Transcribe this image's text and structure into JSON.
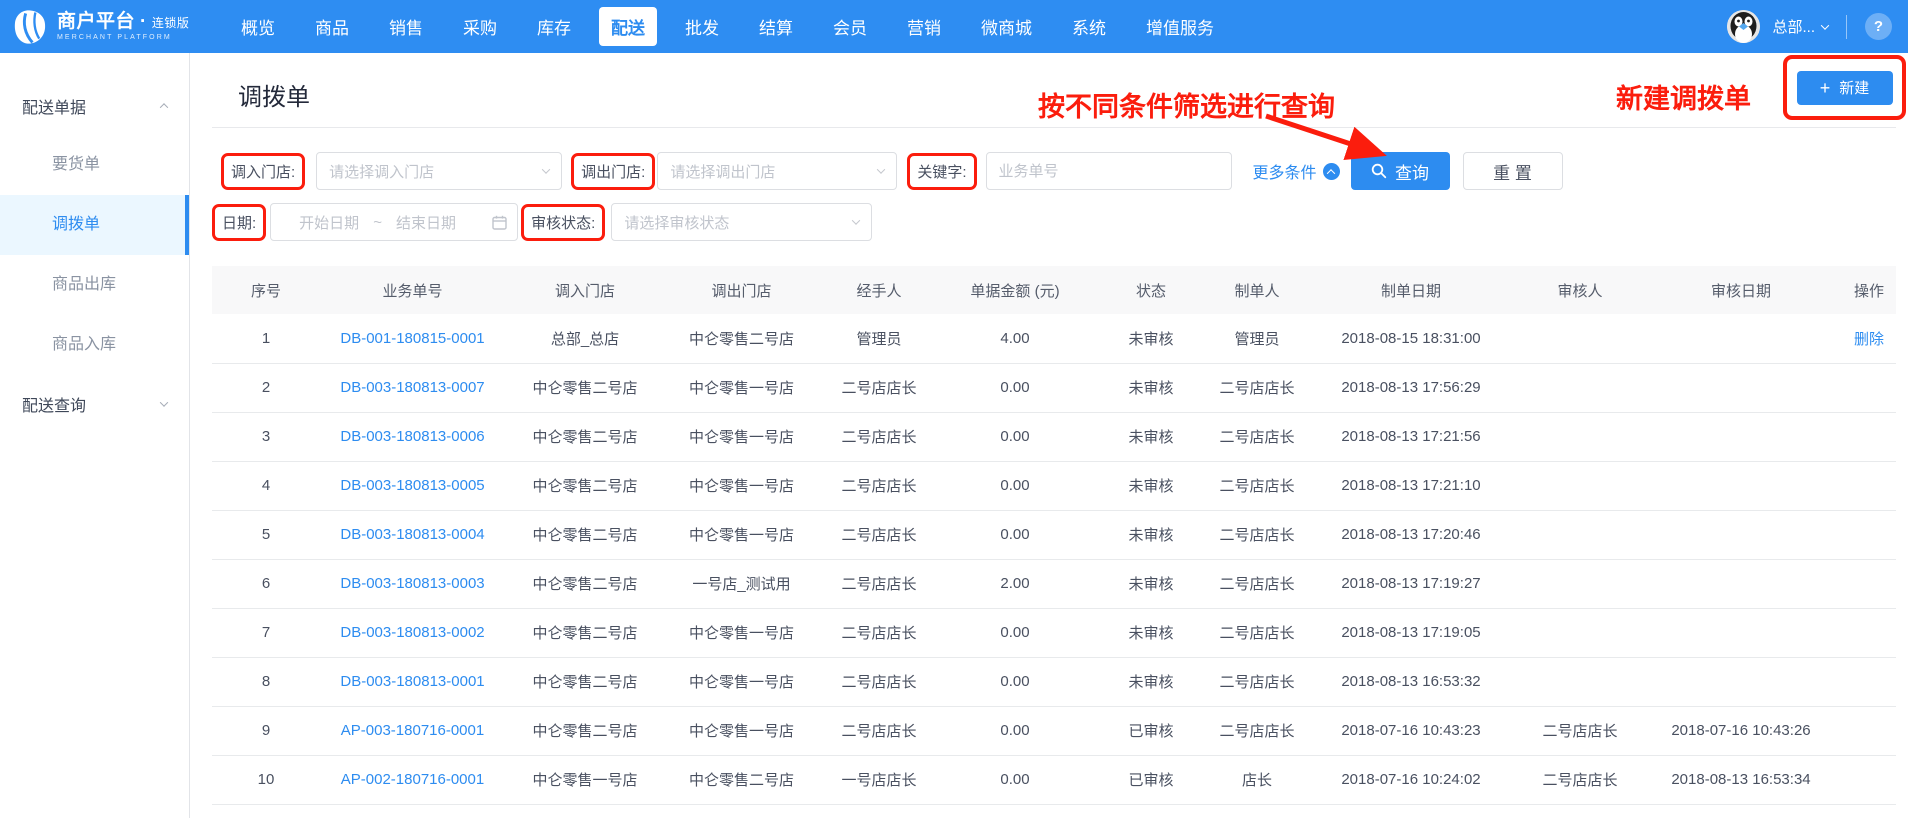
{
  "colors": {
    "accent": "#2d8cf0",
    "nav_background": "#2e8df2",
    "annotation_red": "#fb1d0d",
    "link_blue": "#2d8cf0",
    "sidebar_active_bg": "#ebf7ff"
  },
  "topnav": {
    "brand": {
      "title": "商户平台",
      "separator": "·",
      "edition": "连锁版",
      "subtitle": "MERCHANT PLATFORM"
    },
    "items": [
      {
        "label": "概览"
      },
      {
        "label": "商品"
      },
      {
        "label": "销售"
      },
      {
        "label": "采购"
      },
      {
        "label": "库存"
      },
      {
        "label": "配送",
        "active": true
      },
      {
        "label": "批发"
      },
      {
        "label": "结算"
      },
      {
        "label": "会员"
      },
      {
        "label": "营销"
      },
      {
        "label": "微商城"
      },
      {
        "label": "系统"
      },
      {
        "label": "增值服务"
      }
    ],
    "user": {
      "name": "总部..."
    },
    "help_glyph": "?"
  },
  "sidebar": {
    "group1": {
      "label": "配送单据",
      "items": [
        {
          "label": "要货单"
        },
        {
          "label": "调拨单",
          "active": true
        },
        {
          "label": "商品出库"
        },
        {
          "label": "商品入库"
        }
      ]
    },
    "group2": {
      "label": "配送查询"
    }
  },
  "page": {
    "title": "调拨单",
    "annotations": {
      "filter_note": "按不同条件筛选进行查询",
      "new_note": "新建调拨单"
    },
    "filters": {
      "store_in_label": "调入门店:",
      "store_in_placeholder": "请选择调入门店",
      "store_out_label": "调出门店:",
      "store_out_placeholder": "请选择调出门店",
      "keyword_label": "关键字:",
      "keyword_placeholder": "业务单号",
      "date_label": "日期:",
      "date_start_placeholder": "开始日期",
      "date_separator": "~",
      "date_end_placeholder": "结束日期",
      "audit_label": "审核状态:",
      "audit_placeholder": "请选择审核状态",
      "more_label": "更多条件",
      "search_label": "查询",
      "reset_label": "重 置"
    },
    "new_button": {
      "plus": "+",
      "label": "新建"
    },
    "table": {
      "columns": [
        "序号",
        "业务单号",
        "调入门店",
        "调出门店",
        "经手人",
        "单据金额 (元)",
        "状态",
        "制单人",
        "制单日期",
        "审核人",
        "审核日期",
        "操作"
      ],
      "rows": [
        {
          "no": "1",
          "order_no": "DB-001-180815-0001",
          "store_in": "总部_总店",
          "store_out": "中仑零售二号店",
          "handler": "管理员",
          "amount": "4.00",
          "status": "未审核",
          "creator": "管理员",
          "created_at": "2018-08-15 18:31:00",
          "auditor": "",
          "audited_at": "",
          "action": "删除"
        },
        {
          "no": "2",
          "order_no": "DB-003-180813-0007",
          "store_in": "中仑零售二号店",
          "store_out": "中仑零售一号店",
          "handler": "二号店店长",
          "amount": "0.00",
          "status": "未审核",
          "creator": "二号店店长",
          "created_at": "2018-08-13 17:56:29",
          "auditor": "",
          "audited_at": "",
          "action": ""
        },
        {
          "no": "3",
          "order_no": "DB-003-180813-0006",
          "store_in": "中仑零售二号店",
          "store_out": "中仑零售一号店",
          "handler": "二号店店长",
          "amount": "0.00",
          "status": "未审核",
          "creator": "二号店店长",
          "created_at": "2018-08-13 17:21:56",
          "auditor": "",
          "audited_at": "",
          "action": ""
        },
        {
          "no": "4",
          "order_no": "DB-003-180813-0005",
          "store_in": "中仑零售二号店",
          "store_out": "中仑零售一号店",
          "handler": "二号店店长",
          "amount": "0.00",
          "status": "未审核",
          "creator": "二号店店长",
          "created_at": "2018-08-13 17:21:10",
          "auditor": "",
          "audited_at": "",
          "action": ""
        },
        {
          "no": "5",
          "order_no": "DB-003-180813-0004",
          "store_in": "中仑零售二号店",
          "store_out": "中仑零售一号店",
          "handler": "二号店店长",
          "amount": "0.00",
          "status": "未审核",
          "creator": "二号店店长",
          "created_at": "2018-08-13 17:20:46",
          "auditor": "",
          "audited_at": "",
          "action": ""
        },
        {
          "no": "6",
          "order_no": "DB-003-180813-0003",
          "store_in": "中仑零售二号店",
          "store_out": "一号店_测试用",
          "handler": "二号店店长",
          "amount": "2.00",
          "status": "未审核",
          "creator": "二号店店长",
          "created_at": "2018-08-13 17:19:27",
          "auditor": "",
          "audited_at": "",
          "action": ""
        },
        {
          "no": "7",
          "order_no": "DB-003-180813-0002",
          "store_in": "中仑零售二号店",
          "store_out": "中仑零售一号店",
          "handler": "二号店店长",
          "amount": "0.00",
          "status": "未审核",
          "creator": "二号店店长",
          "created_at": "2018-08-13 17:19:05",
          "auditor": "",
          "audited_at": "",
          "action": ""
        },
        {
          "no": "8",
          "order_no": "DB-003-180813-0001",
          "store_in": "中仑零售二号店",
          "store_out": "中仑零售一号店",
          "handler": "二号店店长",
          "amount": "0.00",
          "status": "未审核",
          "creator": "二号店店长",
          "created_at": "2018-08-13 16:53:32",
          "auditor": "",
          "audited_at": "",
          "action": ""
        },
        {
          "no": "9",
          "order_no": "AP-003-180716-0001",
          "store_in": "中仑零售二号店",
          "store_out": "中仑零售一号店",
          "handler": "二号店店长",
          "amount": "0.00",
          "status": "已审核",
          "creator": "二号店店长",
          "created_at": "2018-07-16 10:43:23",
          "auditor": "二号店店长",
          "audited_at": "2018-07-16 10:43:26",
          "action": ""
        },
        {
          "no": "10",
          "order_no": "AP-002-180716-0001",
          "store_in": "中仑零售一号店",
          "store_out": "中仑零售二号店",
          "handler": "一号店店长",
          "amount": "0.00",
          "status": "已审核",
          "creator": "店长",
          "created_at": "2018-07-16 10:24:02",
          "auditor": "二号店店长",
          "audited_at": "2018-08-13 16:53:34",
          "action": ""
        }
      ]
    }
  }
}
